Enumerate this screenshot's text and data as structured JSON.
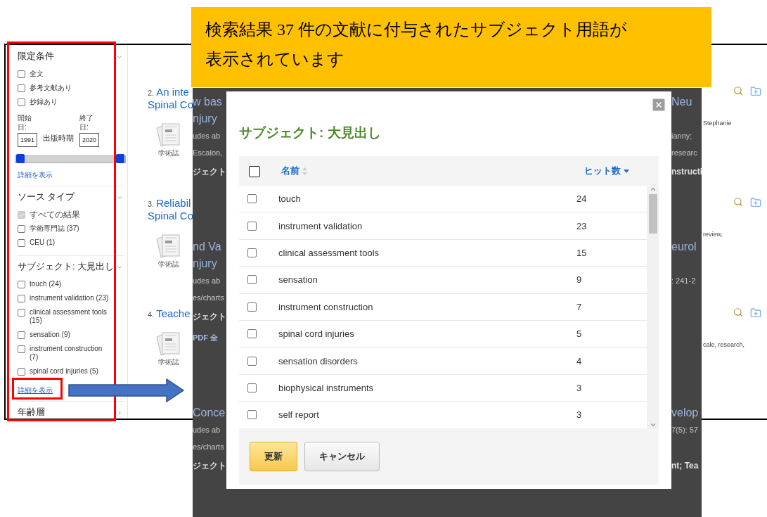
{
  "callout": {
    "lines": [
      "検索結果 37 件の文献に付与されたサブジェクト用語が",
      "表示されています"
    ]
  },
  "sidebar": {
    "sections": [
      {
        "kind": "limiters",
        "title": "限定条件",
        "expanded": true,
        "options": [
          {
            "label": "全文",
            "checked": false
          },
          {
            "label": "参考文献あり",
            "checked": false
          },
          {
            "label": "抄録あり",
            "checked": false
          }
        ],
        "date": {
          "start_label": "開始日:",
          "end_label": "終了日:",
          "start_value": "1991",
          "end_value": "2020",
          "caption": "出版時期"
        },
        "slider": {
          "level": 1
        },
        "show_more": "詳細を表示"
      },
      {
        "kind": "checklist",
        "title": "ソース タイプ",
        "expanded": true,
        "options": [
          {
            "label": "すべての結果",
            "checked": true,
            "disabled": true
          },
          {
            "label": "学術専門誌 (37)",
            "checked": false,
            "disabled": false
          },
          {
            "label": "CEU (1)",
            "checked": false,
            "disabled": false
          }
        ]
      },
      {
        "kind": "checklist",
        "title": "サブジェクト: 大見出し",
        "expanded": true,
        "options": [
          {
            "label": "touch (24)",
            "checked": false,
            "disabled": false
          },
          {
            "label": "instrument validation (23)",
            "checked": false,
            "disabled": false
          },
          {
            "label": "clinical assessment tools (15)",
            "checked": false,
            "disabled": false
          },
          {
            "label": "sensation (9)",
            "checked": false,
            "disabled": false
          },
          {
            "label": "instrument construction (7)",
            "checked": false,
            "disabled": false
          },
          {
            "label": "spinal cord injuries (5)",
            "checked": false,
            "disabled": false
          }
        ],
        "show_more": "詳細を表示"
      },
      {
        "kind": "collapsed",
        "title": "年齢層",
        "expanded": false
      }
    ]
  },
  "results": [
    {
      "number": "2.",
      "title_lines": [
        "An inte",
        "Spinal Co"
      ],
      "type_label": "学術誌",
      "side_text": "Stephanie"
    },
    {
      "number": "3.",
      "title_lines": [
        "Reliabil",
        "Spinal Co"
      ],
      "type_label": "学術誌",
      "side_text": "review,"
    },
    {
      "number": "4.",
      "title_lines": [
        "Teache"
      ],
      "type_label": "学術誌",
      "side_text": "cale, research,"
    }
  ],
  "backdrop": {
    "records": [
      {
        "rows": [
          {
            "kind": "title",
            "left": "w bas",
            "right": "Neu"
          },
          {
            "kind": "title",
            "left": "njury"
          },
          {
            "kind": "body",
            "left": "udes ab",
            "right": "ianny;"
          },
          {
            "kind": "body",
            "left": "Escalon,",
            "right": "researc"
          },
          {
            "kind": "label",
            "left": "ジェクト",
            "right": "nstructi"
          }
        ]
      },
      {
        "rows": [
          {
            "kind": "title",
            "left": "nd Va",
            "right": "eurol"
          },
          {
            "kind": "title",
            "left": "njury"
          },
          {
            "kind": "body",
            "left": "udes ab",
            "right": ": 241-2"
          },
          {
            "kind": "body",
            "left": "es/charts"
          },
          {
            "kind": "label",
            "left": "ジェクト"
          },
          {
            "kind": "link",
            "left": "PDF 全"
          }
        ]
      },
      {
        "rows": [
          {
            "kind": "title",
            "left": "Conce",
            "right": "velop"
          },
          {
            "kind": "body",
            "left": "udes ab",
            "right": "7(5): 57"
          },
          {
            "kind": "body",
            "left": "es/charts"
          },
          {
            "kind": "label",
            "left": "ジェクト",
            "right": "nt; Tea"
          }
        ]
      }
    ]
  },
  "modal": {
    "title": "サブジェクト: 大見出し",
    "columns": {
      "name": "名前",
      "hits": "ヒット数"
    },
    "select_all_checked": false,
    "rows": [
      {
        "name": "touch",
        "hits": "24",
        "checked": false
      },
      {
        "name": "instrument validation",
        "hits": "23",
        "checked": false
      },
      {
        "name": "clinical assessment tools",
        "hits": "15",
        "checked": false
      },
      {
        "name": "sensation",
        "hits": "9",
        "checked": false
      },
      {
        "name": "instrument construction",
        "hits": "7",
        "checked": false
      },
      {
        "name": "spinal cord injuries",
        "hits": "5",
        "checked": false
      },
      {
        "name": "sensation disorders",
        "hits": "4",
        "checked": false
      },
      {
        "name": "biophysical instruments",
        "hits": "3",
        "checked": false
      },
      {
        "name": "self report",
        "hits": "3",
        "checked": false
      }
    ],
    "buttons": [
      {
        "label": "更新",
        "kind": "primary"
      },
      {
        "label": "キャンセル",
        "kind": "secondary"
      }
    ]
  }
}
